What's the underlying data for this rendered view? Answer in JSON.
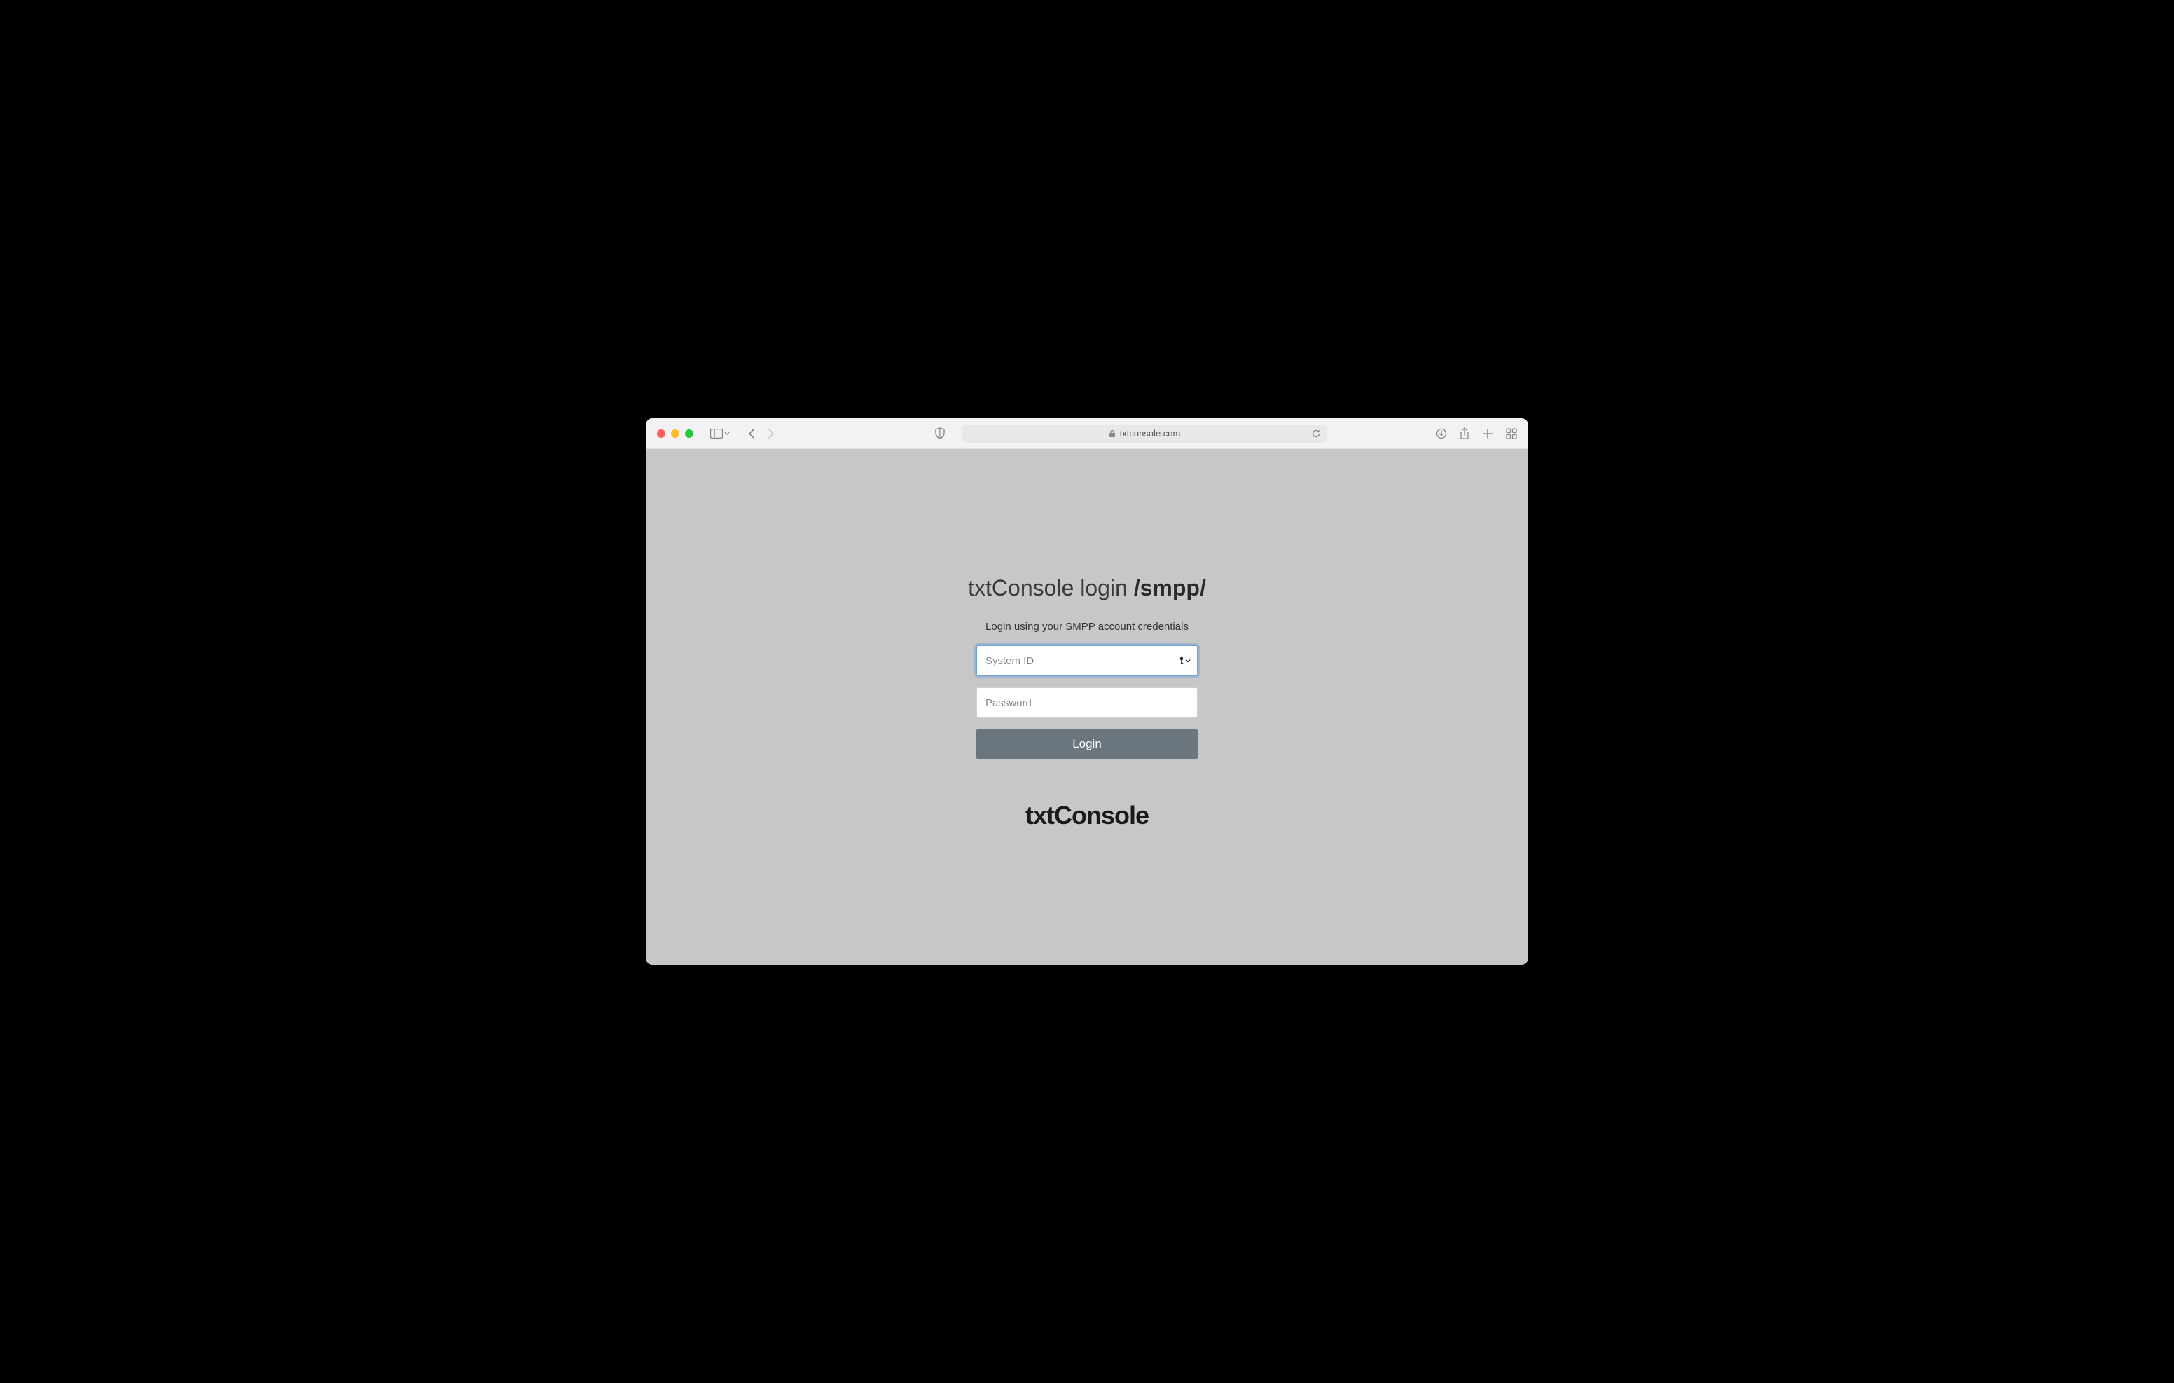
{
  "browser": {
    "url": "txtconsole.com"
  },
  "page": {
    "title_prefix": "txtConsole login ",
    "title_suffix": "/smpp/",
    "subtitle": "Login using your SMPP account credentials",
    "system_id_placeholder": "System ID",
    "password_placeholder": "Password",
    "login_button": "Login",
    "brand": "txtConsole"
  }
}
